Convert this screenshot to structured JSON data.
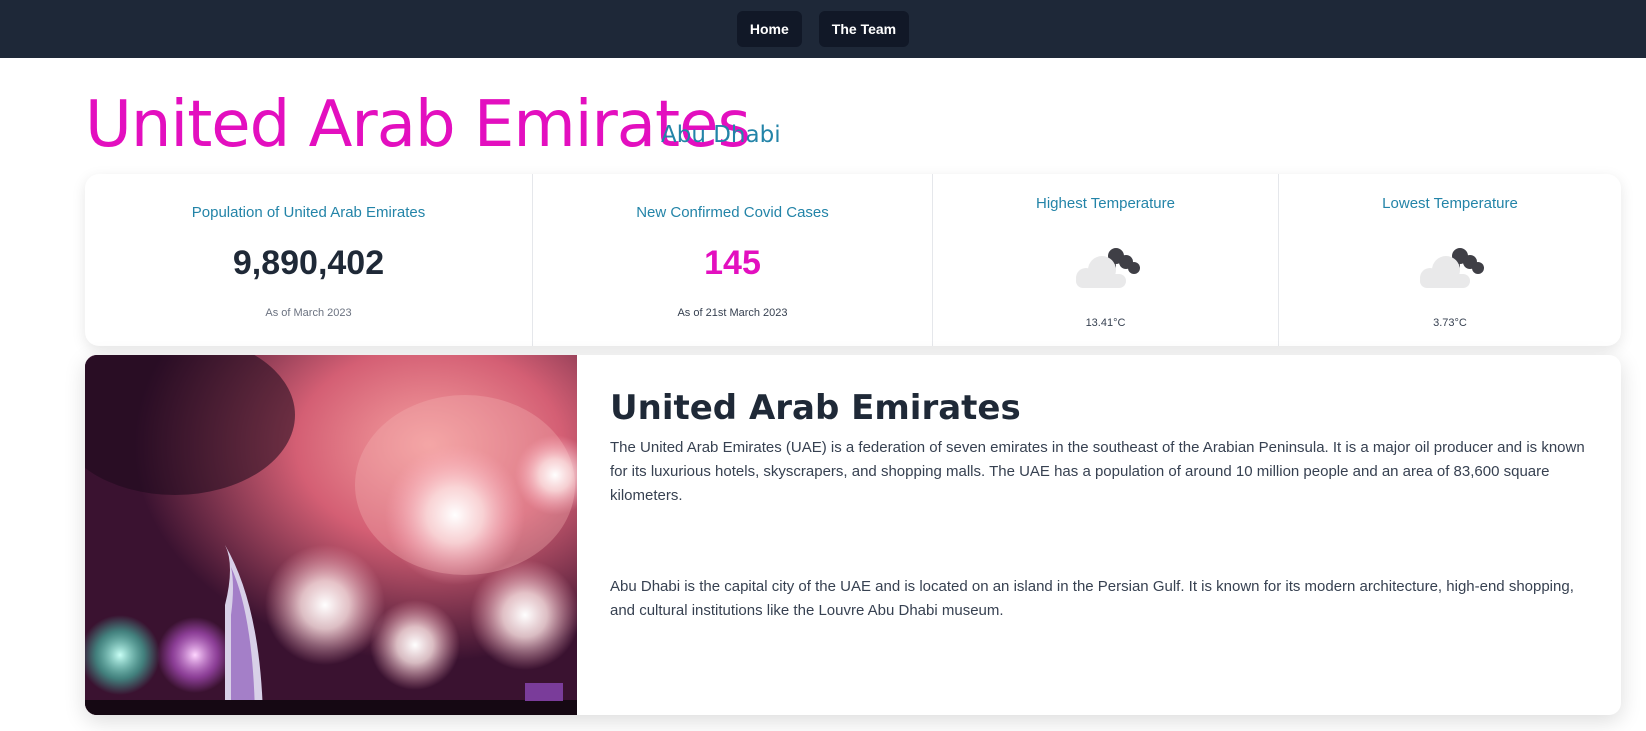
{
  "nav": {
    "home_label": "Home",
    "team_label": "The Team"
  },
  "header": {
    "country": "United Arab Emirates",
    "capital": "Abu Dhabi"
  },
  "stats": {
    "population": {
      "title": "Population of United Arab Emirates",
      "value": "9,890,402",
      "note": "As of March 2023"
    },
    "covid": {
      "title": "New Confirmed Covid Cases",
      "value": "145",
      "note": "As of 21st March 2023",
      "color": "#e30fbf"
    },
    "high_temp": {
      "title": "Highest Temperature",
      "icon": "cloudy-icon",
      "value": "13.41°C"
    },
    "low_temp": {
      "title": "Lowest Temperature",
      "icon": "cloudy-icon",
      "value": "3.73°C"
    }
  },
  "info": {
    "image": "fireworks-over-burj-al-arab",
    "title": "United Arab Emirates",
    "paragraph1": "The United Arab Emirates (UAE) is a federation of seven emirates in the southeast of the Arabian Peninsula. It is a major oil producer and is known for its luxurious hotels, skyscrapers, and shopping malls. The UAE has a population of around 10 million people and an area of 83,600 square kilometers.",
    "paragraph2": "Abu Dhabi is the capital city of the UAE and is located on an island in the Persian Gulf. It is known for its modern architecture, high-end shopping, and cultural institutions like the Louvre Abu Dhabi museum."
  },
  "colors": {
    "navbar": "#1e2838",
    "accent_pink": "#e30fbf",
    "accent_teal": "#2384a8"
  }
}
